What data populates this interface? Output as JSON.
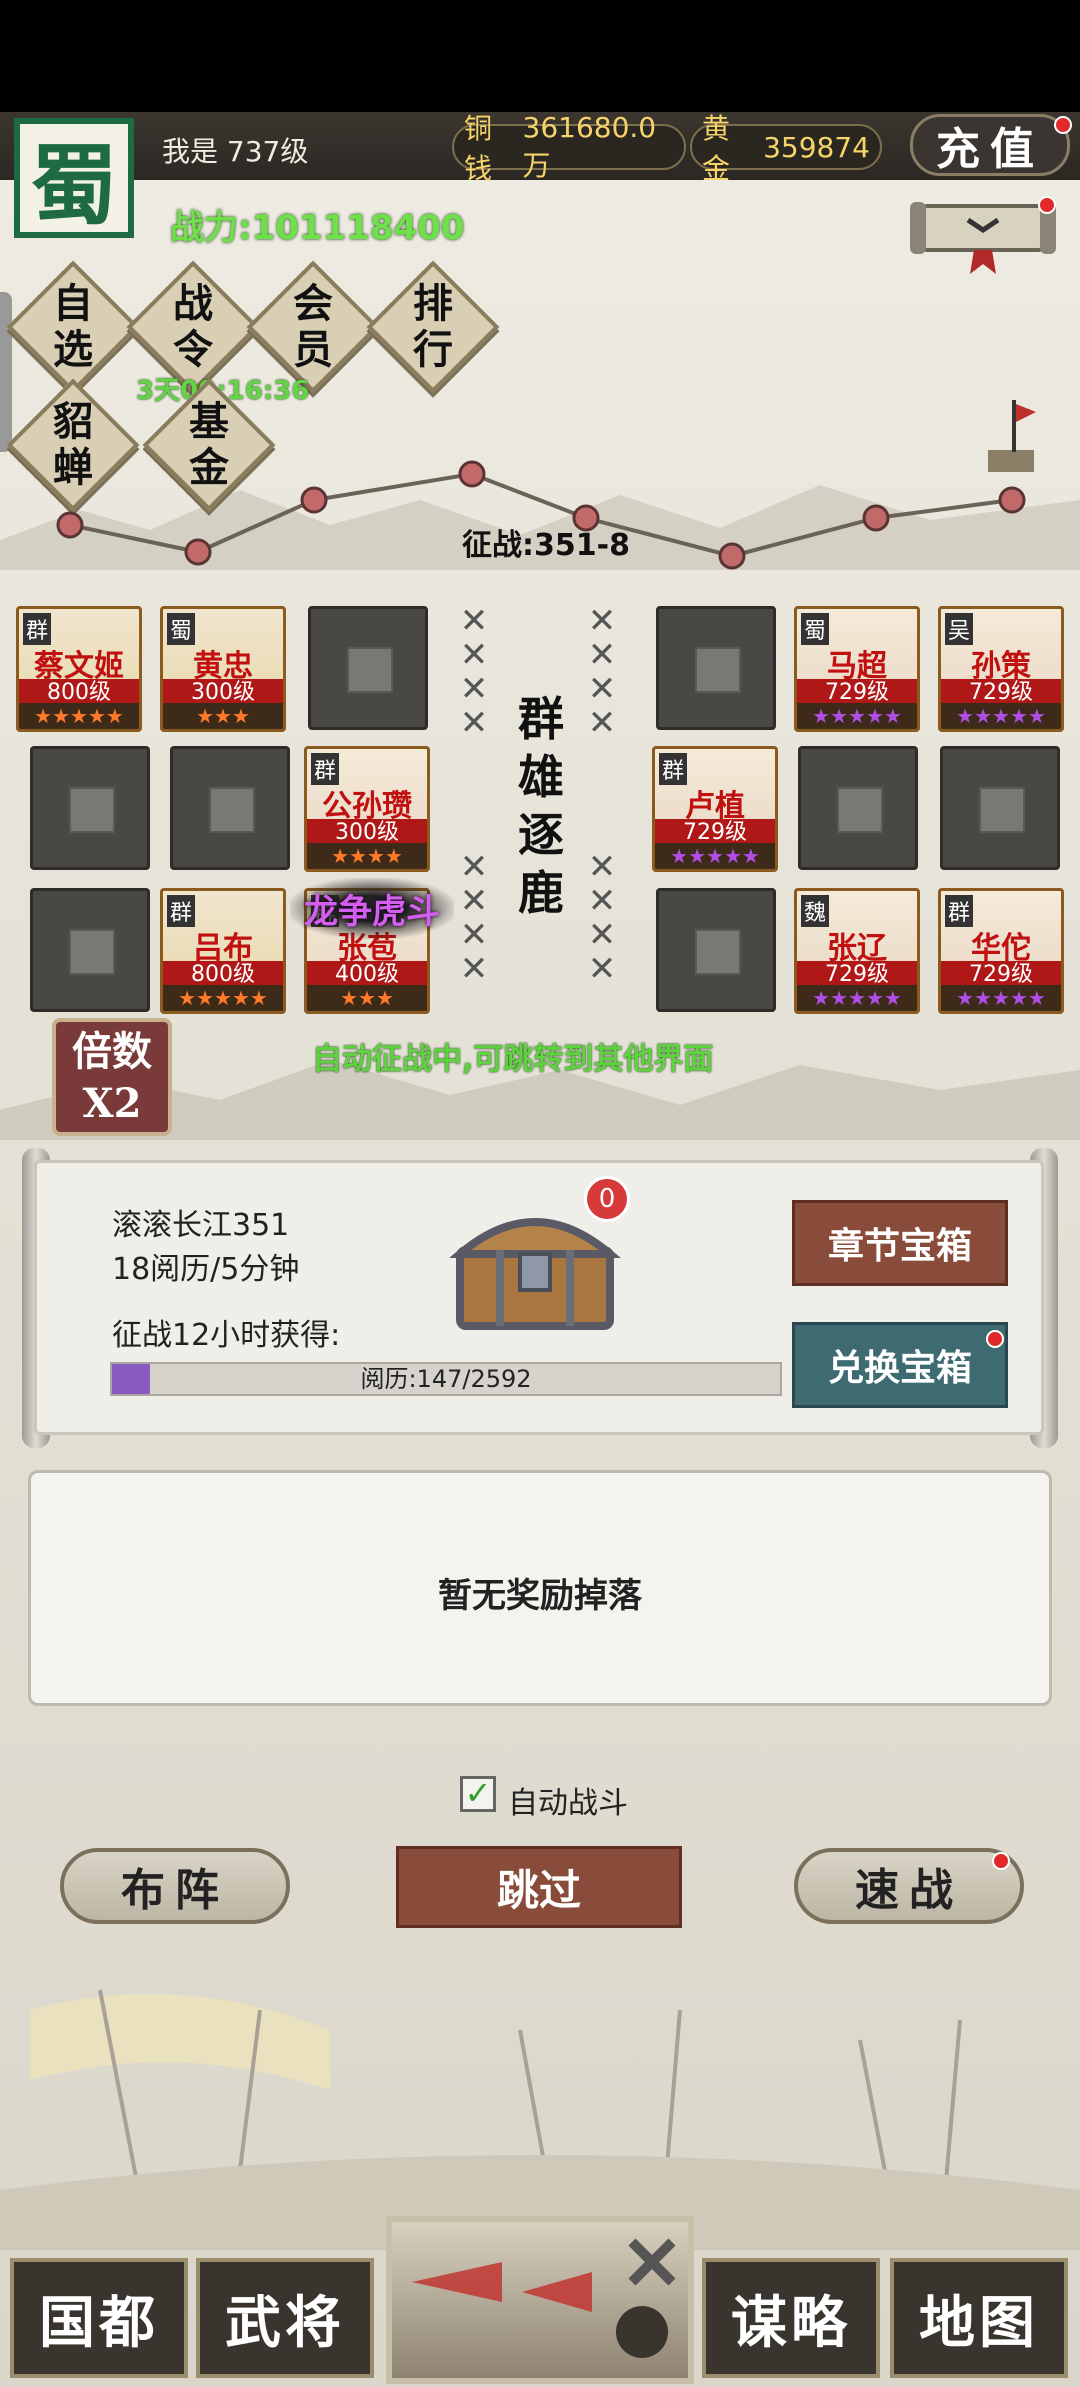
{
  "header": {
    "faction": "蜀",
    "player_level": "我是  737级",
    "power": "战力:101118400",
    "copper_label": "铜钱",
    "copper_value": "361680.0万",
    "gold_label": "黄金",
    "gold_value": "359874",
    "recharge": "充值"
  },
  "menu": [
    {
      "l1": "自",
      "l2": "选"
    },
    {
      "l1": "战",
      "l2": "令"
    },
    {
      "l1": "会",
      "l2": "员"
    },
    {
      "l1": "排",
      "l2": "行"
    },
    {
      "l1": "貂",
      "l2": "蝉"
    },
    {
      "l1": "基",
      "l2": "金"
    }
  ],
  "timer": "3天00:16:36",
  "stage": "征战:351-8",
  "battle_title": [
    "群",
    "雄",
    "逐",
    "鹿"
  ],
  "left_team": [
    {
      "faction": "群",
      "name": "蔡文姬",
      "level": "800级",
      "stars": "★★★★★",
      "tone": "gold"
    },
    {
      "faction": "蜀",
      "name": "黄忠",
      "level": "300级",
      "stars": "★★★",
      "tone": "gold"
    },
    {
      "faction": "群",
      "name": "公孙瓒",
      "level": "300级",
      "stars": "★★★★",
      "tone": "red"
    },
    {
      "faction": "群",
      "name": "吕布",
      "level": "800级",
      "stars": "★★★★★",
      "tone": "gold"
    },
    {
      "faction": "群",
      "name": "张苞",
      "level": "400级",
      "stars": "★★★",
      "tone": "red"
    }
  ],
  "right_team": [
    {
      "faction": "蜀",
      "name": "马超",
      "level": "729级",
      "stars": "★★★★★",
      "tone": "red"
    },
    {
      "faction": "吴",
      "name": "孙策",
      "level": "729级",
      "stars": "★★★★★",
      "tone": "red"
    },
    {
      "faction": "群",
      "name": "卢植",
      "level": "729级",
      "stars": "★★★★★",
      "tone": "red"
    },
    {
      "faction": "魏",
      "name": "张辽",
      "level": "729级",
      "stars": "★★★★★",
      "tone": "red"
    },
    {
      "faction": "群",
      "name": "华佗",
      "level": "729级",
      "stars": "★★★★★",
      "tone": "red"
    }
  ],
  "skill_popup": "龙争虎斗",
  "auto_message": "自动征战中,可跳转到其他界面",
  "multiplier": {
    "l1": "倍数",
    "l2": "X2"
  },
  "chapter": {
    "name": "滚滚长江351",
    "rate": "18阅历/5分钟",
    "earn_label": "征战12小时获得:",
    "progress_text": "阅历:147/2592",
    "progress_fraction": 0.057,
    "chest_badge": "0"
  },
  "buttons": {
    "chapter_chest": "章节宝箱",
    "exchange_chest": "兑换宝箱",
    "formation": "布阵",
    "skip": "跳过",
    "quick_battle": "速战"
  },
  "drops_empty": "暂无奖励掉落",
  "auto_battle": {
    "label": "自动战斗",
    "checked": "✓"
  },
  "bottom_nav": [
    "国都",
    "武将",
    "谋略",
    "地图"
  ],
  "colors": {
    "power_green": "#6de04a",
    "red_badge": "#e02a2a",
    "purple_star": "#b24ee8"
  }
}
